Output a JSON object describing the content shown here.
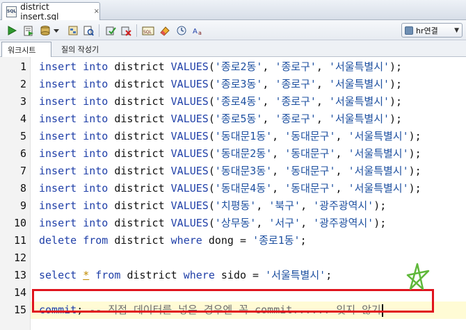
{
  "tab": {
    "title": "district insert.sql",
    "close": "×"
  },
  "toolbar": {
    "icons": [
      "run-icon",
      "run-script-icon",
      "commit-icon",
      "dropdown-arrow-icon",
      "explain-icon",
      "autotrace-icon",
      "rollback-icon",
      "cancel-icon",
      "sql-tuning-icon",
      "eraser-icon",
      "history-icon",
      "format-icon"
    ],
    "connection": "hr연결"
  },
  "subtabs": {
    "worksheet": "워크시트",
    "query_builder": "질의 작성기"
  },
  "editor": {
    "lines": [
      {
        "num": "1",
        "tokens": [
          [
            "kw",
            "insert"
          ],
          [
            "pun",
            " "
          ],
          [
            "kw",
            "into"
          ],
          [
            "pun",
            " "
          ],
          [
            "id",
            "district"
          ],
          [
            "pun",
            " "
          ],
          [
            "kw",
            "VALUES"
          ],
          [
            "pun",
            "("
          ],
          [
            "str",
            "'종로2동'"
          ],
          [
            "pun",
            ", "
          ],
          [
            "str",
            "'종로구'"
          ],
          [
            "pun",
            ", "
          ],
          [
            "str",
            "'서울특별시'"
          ],
          [
            "pun",
            ");"
          ]
        ]
      },
      {
        "num": "2",
        "tokens": [
          [
            "kw",
            "insert"
          ],
          [
            "pun",
            " "
          ],
          [
            "kw",
            "into"
          ],
          [
            "pun",
            " "
          ],
          [
            "id",
            "district"
          ],
          [
            "pun",
            " "
          ],
          [
            "kw",
            "VALUES"
          ],
          [
            "pun",
            "("
          ],
          [
            "str",
            "'종로3동'"
          ],
          [
            "pun",
            ", "
          ],
          [
            "str",
            "'종로구'"
          ],
          [
            "pun",
            ", "
          ],
          [
            "str",
            "'서울특별시'"
          ],
          [
            "pun",
            ");"
          ]
        ]
      },
      {
        "num": "3",
        "tokens": [
          [
            "kw",
            "insert"
          ],
          [
            "pun",
            " "
          ],
          [
            "kw",
            "into"
          ],
          [
            "pun",
            " "
          ],
          [
            "id",
            "district"
          ],
          [
            "pun",
            " "
          ],
          [
            "kw",
            "VALUES"
          ],
          [
            "pun",
            "("
          ],
          [
            "str",
            "'종로4동'"
          ],
          [
            "pun",
            ", "
          ],
          [
            "str",
            "'종로구'"
          ],
          [
            "pun",
            ", "
          ],
          [
            "str",
            "'서울특별시'"
          ],
          [
            "pun",
            ");"
          ]
        ]
      },
      {
        "num": "4",
        "tokens": [
          [
            "kw",
            "insert"
          ],
          [
            "pun",
            " "
          ],
          [
            "kw",
            "into"
          ],
          [
            "pun",
            " "
          ],
          [
            "id",
            "district"
          ],
          [
            "pun",
            " "
          ],
          [
            "kw",
            "VALUES"
          ],
          [
            "pun",
            "("
          ],
          [
            "str",
            "'종로5동'"
          ],
          [
            "pun",
            ", "
          ],
          [
            "str",
            "'종로구'"
          ],
          [
            "pun",
            ", "
          ],
          [
            "str",
            "'서울특별시'"
          ],
          [
            "pun",
            ");"
          ]
        ]
      },
      {
        "num": "5",
        "tokens": [
          [
            "kw",
            "insert"
          ],
          [
            "pun",
            " "
          ],
          [
            "kw",
            "into"
          ],
          [
            "pun",
            " "
          ],
          [
            "id",
            "district"
          ],
          [
            "pun",
            " "
          ],
          [
            "kw",
            "VALUES"
          ],
          [
            "pun",
            "("
          ],
          [
            "str",
            "'동대문1동'"
          ],
          [
            "pun",
            ", "
          ],
          [
            "str",
            "'동대문구'"
          ],
          [
            "pun",
            ", "
          ],
          [
            "str",
            "'서울특별시'"
          ],
          [
            "pun",
            ");"
          ]
        ]
      },
      {
        "num": "6",
        "tokens": [
          [
            "kw",
            "insert"
          ],
          [
            "pun",
            " "
          ],
          [
            "kw",
            "into"
          ],
          [
            "pun",
            " "
          ],
          [
            "id",
            "district"
          ],
          [
            "pun",
            " "
          ],
          [
            "kw",
            "VALUES"
          ],
          [
            "pun",
            "("
          ],
          [
            "str",
            "'동대문2동'"
          ],
          [
            "pun",
            ", "
          ],
          [
            "str",
            "'동대문구'"
          ],
          [
            "pun",
            ", "
          ],
          [
            "str",
            "'서울특별시'"
          ],
          [
            "pun",
            ");"
          ]
        ]
      },
      {
        "num": "7",
        "tokens": [
          [
            "kw",
            "insert"
          ],
          [
            "pun",
            " "
          ],
          [
            "kw",
            "into"
          ],
          [
            "pun",
            " "
          ],
          [
            "id",
            "district"
          ],
          [
            "pun",
            " "
          ],
          [
            "kw",
            "VALUES"
          ],
          [
            "pun",
            "("
          ],
          [
            "str",
            "'동대문3동'"
          ],
          [
            "pun",
            ", "
          ],
          [
            "str",
            "'동대문구'"
          ],
          [
            "pun",
            ", "
          ],
          [
            "str",
            "'서울특별시'"
          ],
          [
            "pun",
            ");"
          ]
        ]
      },
      {
        "num": "8",
        "tokens": [
          [
            "kw",
            "insert"
          ],
          [
            "pun",
            " "
          ],
          [
            "kw",
            "into"
          ],
          [
            "pun",
            " "
          ],
          [
            "id",
            "district"
          ],
          [
            "pun",
            " "
          ],
          [
            "kw",
            "VALUES"
          ],
          [
            "pun",
            "("
          ],
          [
            "str",
            "'동대문4동'"
          ],
          [
            "pun",
            ", "
          ],
          [
            "str",
            "'동대문구'"
          ],
          [
            "pun",
            ", "
          ],
          [
            "str",
            "'서울특별시'"
          ],
          [
            "pun",
            ");"
          ]
        ]
      },
      {
        "num": "9",
        "tokens": [
          [
            "kw",
            "insert"
          ],
          [
            "pun",
            " "
          ],
          [
            "kw",
            "into"
          ],
          [
            "pun",
            " "
          ],
          [
            "id",
            "district"
          ],
          [
            "pun",
            " "
          ],
          [
            "kw",
            "VALUES"
          ],
          [
            "pun",
            "("
          ],
          [
            "str",
            "'치평동'"
          ],
          [
            "pun",
            ", "
          ],
          [
            "str",
            "'북구'"
          ],
          [
            "pun",
            ", "
          ],
          [
            "str",
            "'광주광역시'"
          ],
          [
            "pun",
            ");"
          ]
        ]
      },
      {
        "num": "10",
        "tokens": [
          [
            "kw",
            "insert"
          ],
          [
            "pun",
            " "
          ],
          [
            "kw",
            "into"
          ],
          [
            "pun",
            " "
          ],
          [
            "id",
            "district"
          ],
          [
            "pun",
            " "
          ],
          [
            "kw",
            "VALUES"
          ],
          [
            "pun",
            "("
          ],
          [
            "str",
            "'상무동'"
          ],
          [
            "pun",
            ", "
          ],
          [
            "str",
            "'서구'"
          ],
          [
            "pun",
            ", "
          ],
          [
            "str",
            "'광주광역시'"
          ],
          [
            "pun",
            ");"
          ]
        ]
      },
      {
        "num": "11",
        "tokens": [
          [
            "kw",
            "delete"
          ],
          [
            "pun",
            " "
          ],
          [
            "kw",
            "from"
          ],
          [
            "pun",
            " "
          ],
          [
            "id",
            "district"
          ],
          [
            "pun",
            " "
          ],
          [
            "kw",
            "where"
          ],
          [
            "pun",
            " "
          ],
          [
            "id",
            "dong"
          ],
          [
            "pun",
            " = "
          ],
          [
            "str",
            "'종로1동'"
          ],
          [
            "pun",
            ";"
          ]
        ]
      },
      {
        "num": "12",
        "tokens": []
      },
      {
        "num": "13",
        "tokens": [
          [
            "kw",
            "select"
          ],
          [
            "pun",
            " "
          ],
          [
            "star-mark",
            "*"
          ],
          [
            "pun",
            " "
          ],
          [
            "kw",
            "from"
          ],
          [
            "pun",
            " "
          ],
          [
            "id",
            "district"
          ],
          [
            "pun",
            " "
          ],
          [
            "kw",
            "where"
          ],
          [
            "pun",
            " "
          ],
          [
            "id",
            "sido"
          ],
          [
            "pun",
            " = "
          ],
          [
            "str",
            "'서울특별시'"
          ],
          [
            "pun",
            ";"
          ]
        ]
      },
      {
        "num": "14",
        "tokens": []
      },
      {
        "num": "15",
        "tokens": [
          [
            "kw",
            "commit"
          ],
          [
            "pun",
            "; "
          ],
          [
            "cmt",
            "-- 직접 데이터를 넣은 경우엔 꼭 commit...... 잊지 않기"
          ]
        ],
        "current": true
      }
    ]
  },
  "colors": {
    "keyword": "#1f3fa8",
    "string": "#1e50a0",
    "comment": "#6e6e6e",
    "highlight_box": "#e0141e",
    "doodle": "#5fb83a"
  }
}
